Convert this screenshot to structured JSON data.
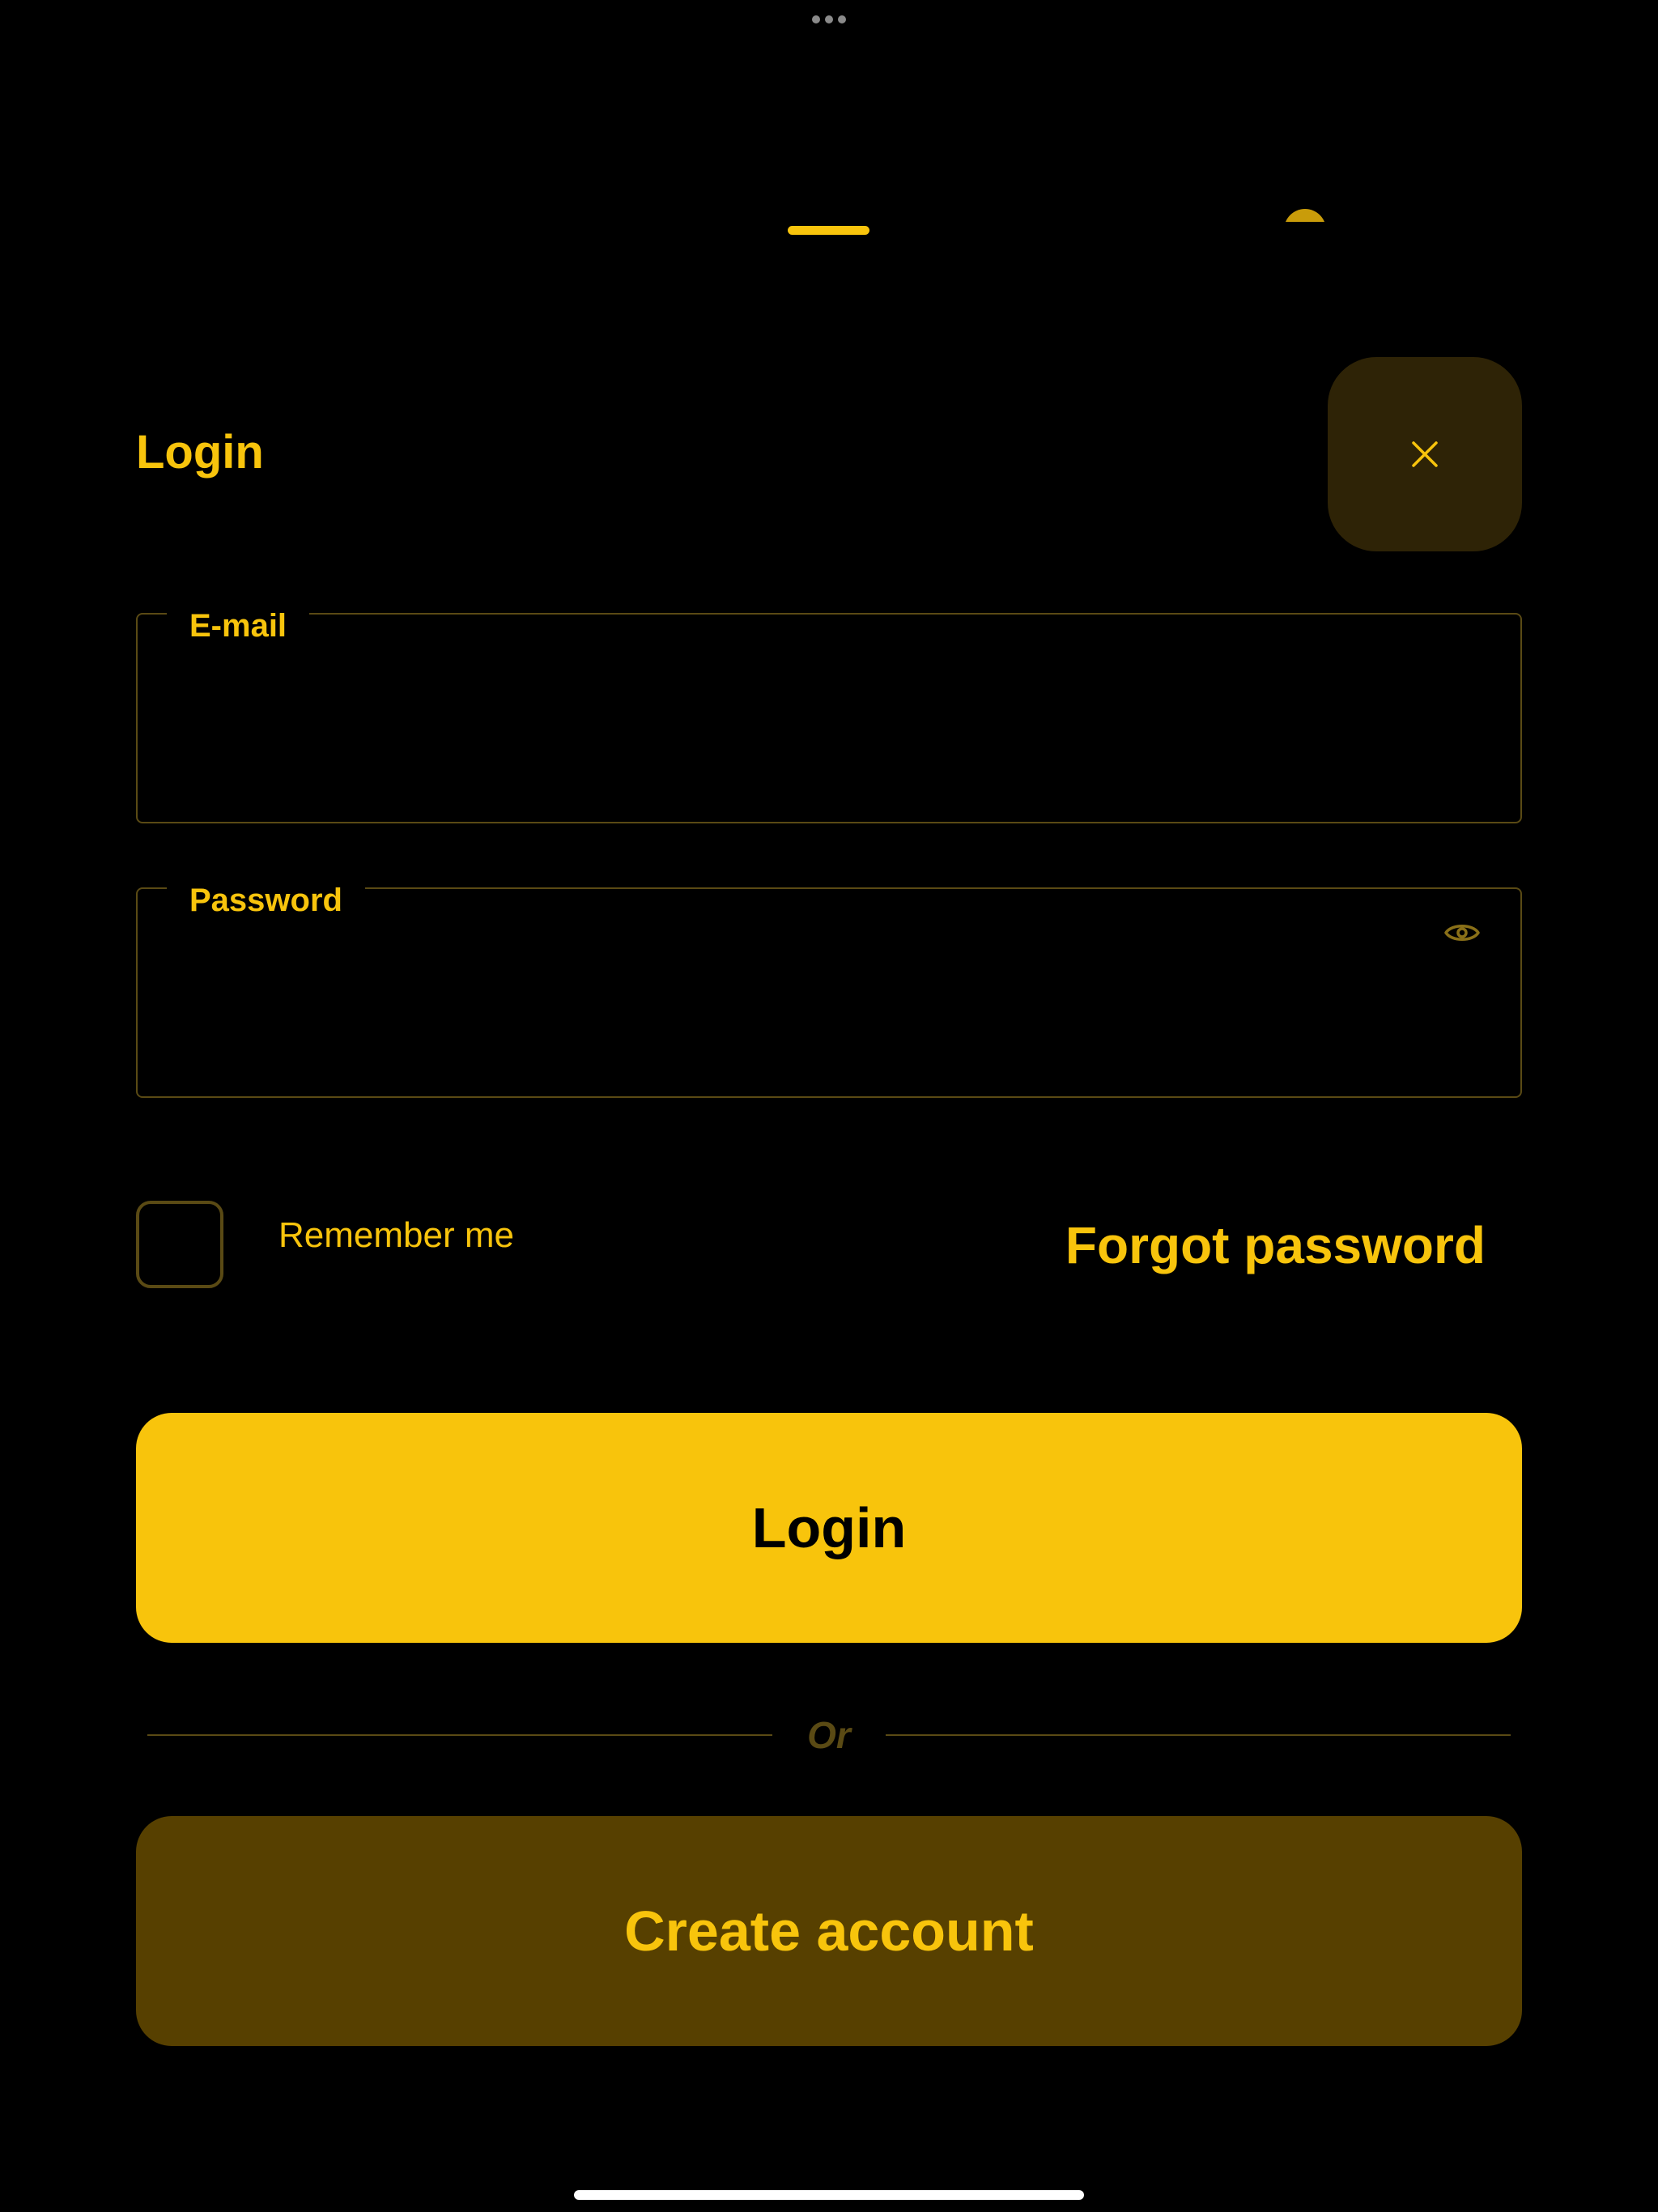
{
  "sheet": {
    "title": "Login",
    "close_icon": "close-icon"
  },
  "form": {
    "email": {
      "label": "E-mail",
      "value": "",
      "placeholder": ""
    },
    "password": {
      "label": "Password",
      "value": "",
      "placeholder": "",
      "toggle_icon": "eye-icon"
    },
    "remember_me": {
      "label": "Remember me",
      "checked": false
    },
    "forgot_password_label": "Forgot password",
    "login_button_label": "Login",
    "divider_text": "Or",
    "create_account_label": "Create account"
  },
  "colors": {
    "background": "#000000",
    "accent": "#F8C40C",
    "accent_muted": "#5A4A14",
    "secondary_button_bg": "#574000",
    "close_button_bg": "#2E2306"
  }
}
